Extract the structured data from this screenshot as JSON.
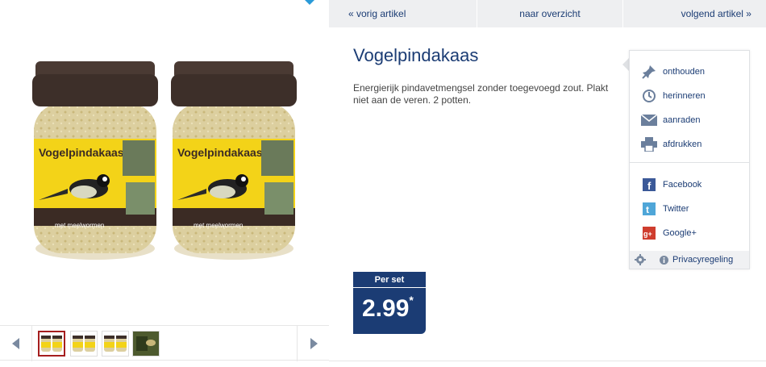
{
  "nav": {
    "prev": "« vorig artikel",
    "overview": "naar overzicht",
    "next": "volgend artikel »"
  },
  "product": {
    "title": "Vogelpindakaas",
    "description": "Energierijk pindavetmengsel zonder toegevoegd zout. Plakt niet aan de veren. 2 potten.",
    "label_text": "Vogelpindakaas",
    "label_subtext": "met meelwormen"
  },
  "price": {
    "unit": "Per set",
    "amount": "2.99",
    "footnote_mark": "*"
  },
  "actions": [
    {
      "label": "onthouden",
      "icon": "pin-icon"
    },
    {
      "label": "herinneren",
      "icon": "clock-icon"
    },
    {
      "label": "aanraden",
      "icon": "mail-icon"
    },
    {
      "label": "afdrukken",
      "icon": "printer-icon"
    }
  ],
  "social": [
    {
      "label": "Facebook",
      "icon": "facebook-icon"
    },
    {
      "label": "Twitter",
      "icon": "twitter-icon"
    },
    {
      "label": "Google+",
      "icon": "googleplus-icon"
    }
  ],
  "privacy": {
    "label": "Privacyregeling"
  },
  "thumbnails": {
    "count": 4,
    "active_index": 0
  },
  "colors": {
    "brand_blue": "#1b3c74",
    "nav_bg": "#eeeff1",
    "jar_lid": "#4a3a33",
    "label_yellow": "#f3d318",
    "active_thumb_border": "#a51e1e"
  }
}
